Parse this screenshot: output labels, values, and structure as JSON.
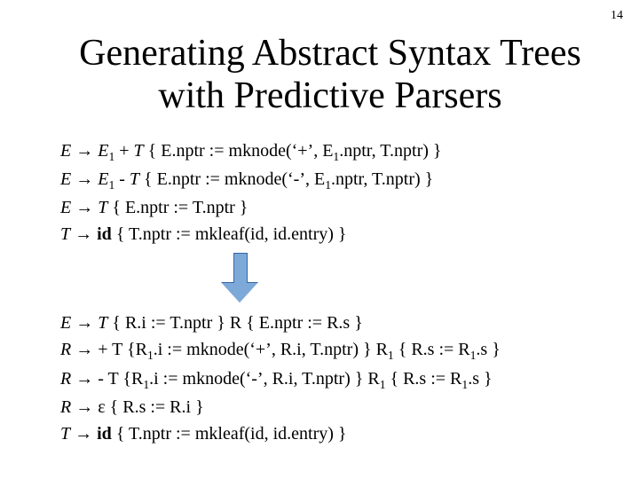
{
  "page_number": "14",
  "title_line1": "Generating Abstract Syntax Trees",
  "title_line2": "with Predictive Parsers",
  "block1": {
    "l1": {
      "lhs": "E",
      "arrow": "→",
      "t1": "E",
      "sub1": "1",
      "t2": " + ",
      "t3": "T",
      "rest": " { E.nptr := mknode(‘+’, E",
      "sub2": "1",
      "rest2": ".nptr, T.nptr) }"
    },
    "l2": {
      "lhs": "E",
      "arrow": "→",
      "t1": "E",
      "sub1": "1",
      "t2": " - ",
      "t3": "T",
      "rest": " { E.nptr := mknode(‘-’, E",
      "sub2": "1",
      "rest2": ".nptr, T.nptr) }"
    },
    "l3": {
      "lhs": "E",
      "arrow": "→",
      "t1": "T",
      "rest": " { E.nptr := T.nptr }"
    },
    "l4": {
      "lhs": "T",
      "arrow": "→",
      "t1": "id",
      "rest": " { T.nptr := mkleaf(id, id.entry) }"
    }
  },
  "block2": {
    "l1": {
      "lhs": "E",
      "arrow": "→",
      "t1": "T",
      "rest": " { R.i := T.nptr } R { E.nptr := R.s }"
    },
    "l2": {
      "lhs": "R",
      "arrow": "→",
      "t1": "+ T",
      "rest": " {R",
      "sub1": "1",
      "rest2": ".i := mknode(‘+’, R.i, T.nptr) } R",
      "sub2": "1",
      "rest3": " { R.s := R",
      "sub3": "1",
      "rest4": ".s }"
    },
    "l3": {
      "lhs": "R",
      "arrow": "→",
      "t1": "- T",
      "rest": " {R",
      "sub1": "1",
      "rest2": ".i := mknode(‘-’, R.i, T.nptr) } R",
      "sub2": "1",
      "rest3": " { R.s := R",
      "sub3": "1",
      "rest4": ".s }"
    },
    "l4": {
      "lhs": "R",
      "arrow": "→",
      "t1": "ε",
      "rest": " { R.s := R.i }"
    },
    "l5": {
      "lhs": "T",
      "arrow": "→",
      "t1": "id",
      "rest": " { T.nptr := mkleaf(id, id.entry) }"
    }
  }
}
